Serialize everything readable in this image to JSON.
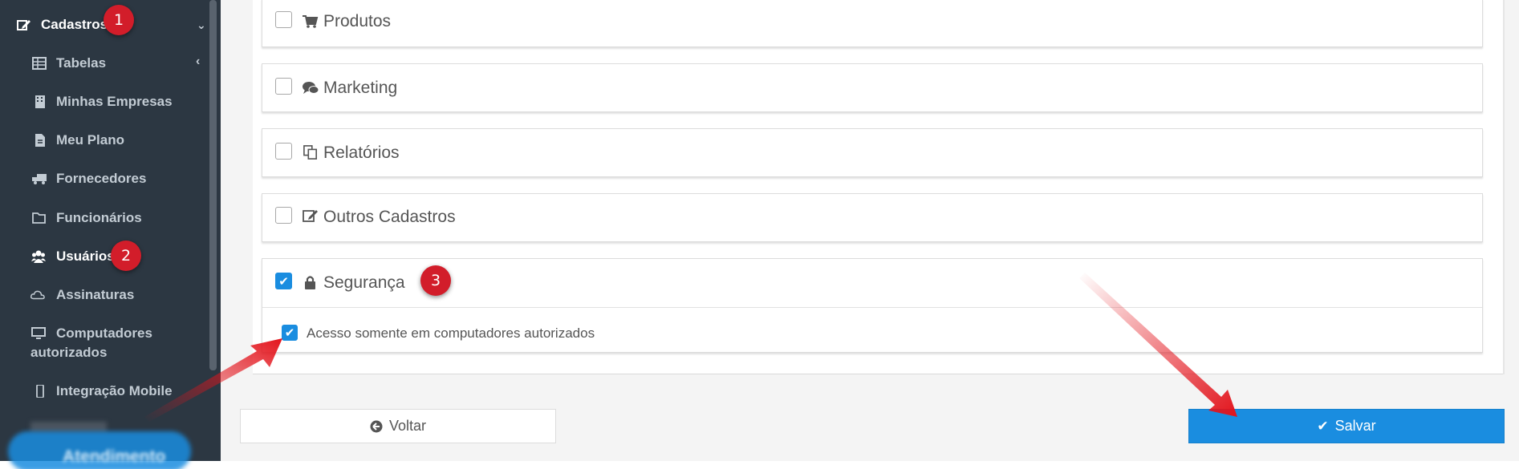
{
  "sidebar": {
    "items": [
      {
        "label": "Cadastros",
        "icon": "edit-icon"
      },
      {
        "label": "Tabelas",
        "icon": "table-icon"
      },
      {
        "label": "Minhas Empresas",
        "icon": "building-icon"
      },
      {
        "label": "Meu Plano",
        "icon": "document-icon"
      },
      {
        "label": "Fornecedores",
        "icon": "truck-icon"
      },
      {
        "label": "Funcionários",
        "icon": "folder-icon"
      },
      {
        "label": "Usuários",
        "icon": "users-icon"
      },
      {
        "label": "Assinaturas",
        "icon": "cloud-icon"
      },
      {
        "label": "Computadores",
        "label2": "autorizados",
        "icon": "desktop-icon"
      },
      {
        "label": "Integração Mobile",
        "icon": "mobile-icon"
      }
    ]
  },
  "badges": [
    "1",
    "2",
    "3"
  ],
  "panels": [
    {
      "title": "Produtos",
      "icon": "cart-icon",
      "checked": false
    },
    {
      "title": "Marketing",
      "icon": "comments-icon",
      "checked": false
    },
    {
      "title": "Relatórios",
      "icon": "copy-icon",
      "checked": false
    },
    {
      "title": "Outros Cadastros",
      "icon": "edit-icon",
      "checked": false
    },
    {
      "title": "Segurança",
      "icon": "lock-icon",
      "checked": true
    }
  ],
  "security_option": {
    "label": "Acesso somente em computadores autorizados",
    "checked": true
  },
  "buttons": {
    "back": "Voltar",
    "save": "Salvar"
  },
  "chat": {
    "label": "Atendimento"
  },
  "colors": {
    "sidebar": "#2c3742",
    "accent": "#1a8de0",
    "badge": "#d21d2a",
    "arrow": "#e3141c"
  }
}
